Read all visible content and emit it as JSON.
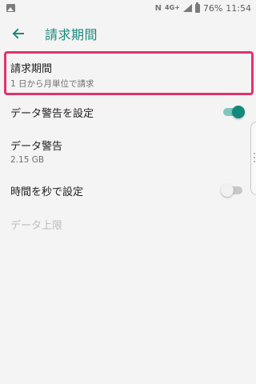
{
  "status_bar": {
    "network_label": "4G+",
    "battery_text": "76%",
    "clock_text": "11:54",
    "icons": [
      "image-icon",
      "nfc-icon",
      "signal-icon",
      "battery-icon"
    ]
  },
  "toolbar": {
    "back_icon": "arrow-back-icon",
    "title": "請求期間",
    "accent_color": "#1a8b7f"
  },
  "settings": {
    "billing_cycle": {
      "title": "請求期間",
      "subtitle": "1 日から月単位で請求"
    },
    "data_warning_toggle": {
      "title": "データ警告を設定",
      "enabled": true
    },
    "data_warning_value": {
      "title": "データ警告",
      "subtitle": "2.15 GB"
    },
    "set_time_seconds": {
      "title": "時間を秒で設定",
      "enabled": false
    },
    "data_limit": {
      "title": "データ上限",
      "disabled": true
    }
  },
  "colors": {
    "highlight": "#e0336d",
    "toggle_on": "#0f8a7c",
    "background": "#f4f4f4"
  }
}
